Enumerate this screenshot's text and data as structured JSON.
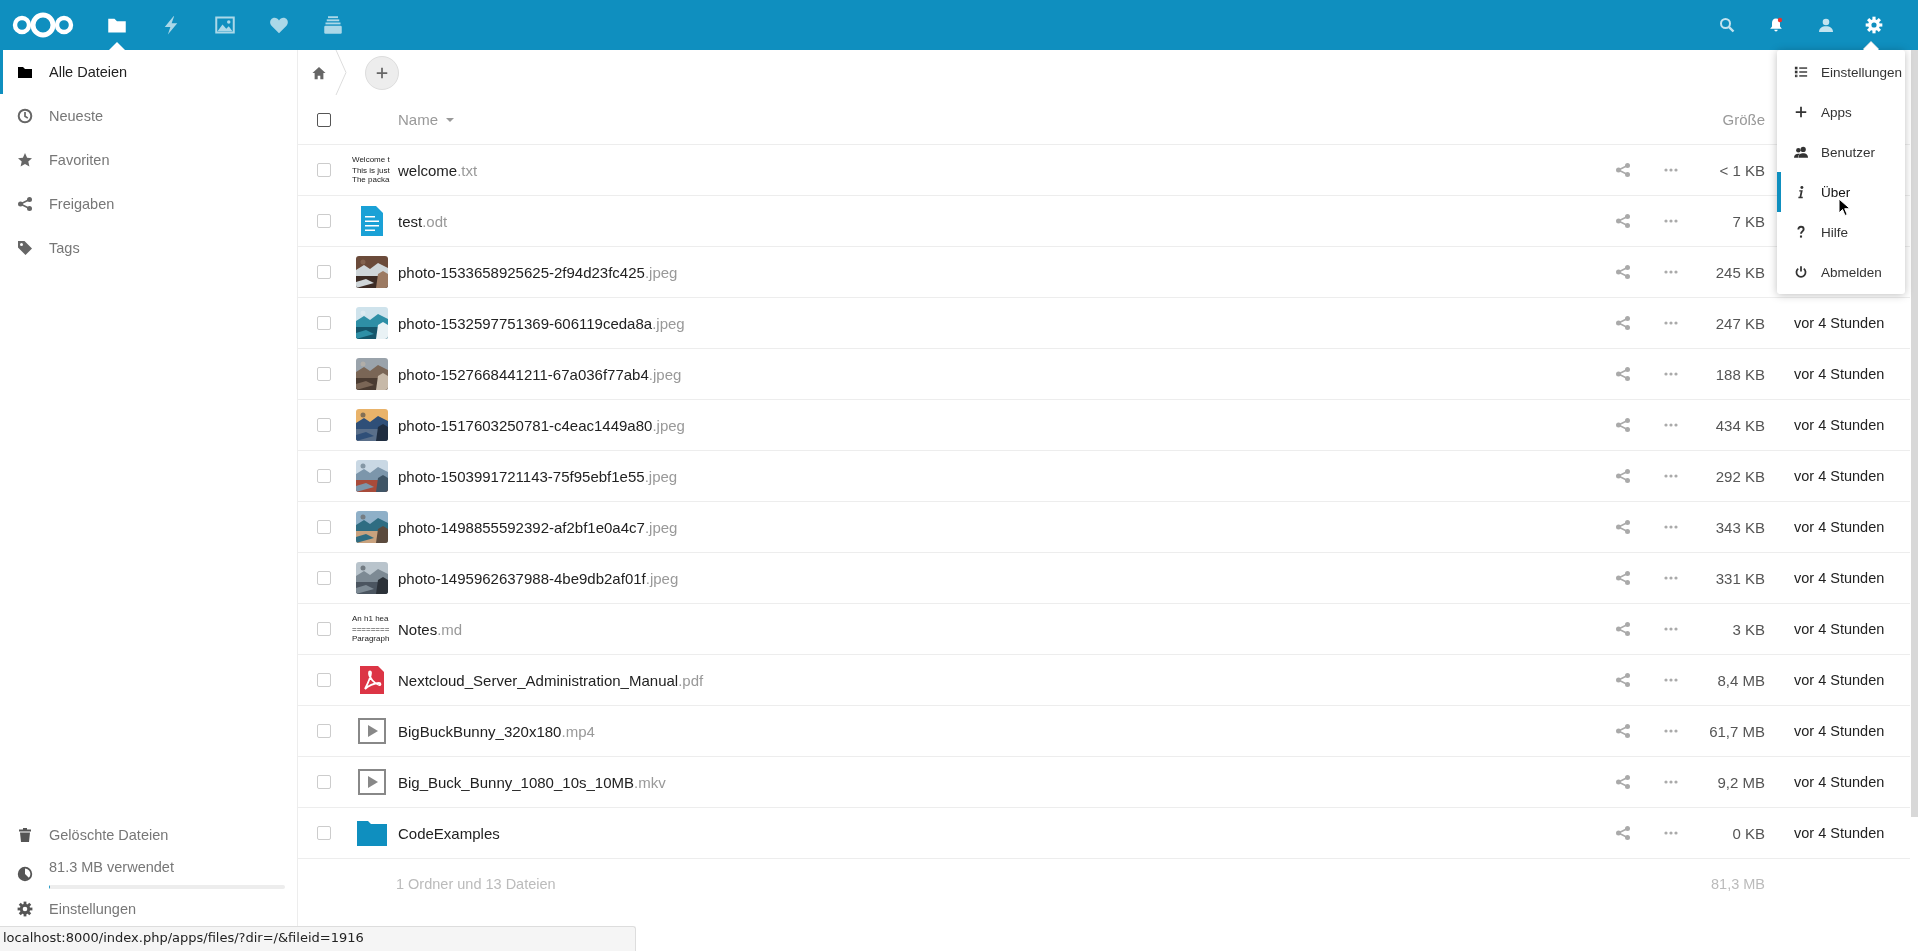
{
  "header": {
    "apps": [
      {
        "kind": "files",
        "selected": true
      },
      {
        "kind": "activity",
        "selected": false
      },
      {
        "kind": "photos",
        "selected": false
      },
      {
        "kind": "favorites",
        "selected": false
      },
      {
        "kind": "deck",
        "selected": false
      }
    ]
  },
  "sidebar": {
    "items": [
      {
        "label": "Alle Dateien",
        "kind": "files",
        "selected": true
      },
      {
        "label": "Neueste",
        "kind": "recent",
        "selected": false
      },
      {
        "label": "Favoriten",
        "kind": "favorites",
        "selected": false
      },
      {
        "label": "Freigaben",
        "kind": "shares",
        "selected": false
      },
      {
        "label": "Tags",
        "kind": "tags",
        "selected": false
      }
    ],
    "deleted": "Gelöschte Dateien",
    "quota": {
      "label": "81.3 MB verwendet",
      "level": 0.005
    },
    "settings": "Einstellungen"
  },
  "table": {
    "columns": [
      "Name",
      "Größe"
    ],
    "select_all": {
      "checked": false
    },
    "rows": [
      {
        "name": "welcome.txt",
        "thumb": {
          "kind": "text-preview",
          "lines": [
            "Welcome t",
            "This is just",
            "The packa"
          ]
        },
        "size": "< 1 KB",
        "checked": false
      },
      {
        "name": "test.odt",
        "thumb": {
          "kind": "document"
        },
        "size": "7 KB",
        "checked": false
      },
      {
        "name": "photo-1533658925625-2f94d23fc425.jpeg",
        "size": "245 KB",
        "checked": false
      },
      {
        "name": "photo-1532597751369-606119ceda8a.jpeg",
        "size": "247 KB",
        "modified": "vor 4 Stunden",
        "checked": false
      },
      {
        "name": "photo-1527668441211-67a036f77ab4.jpeg",
        "size": "188 KB",
        "modified": "vor 4 Stunden",
        "checked": false
      },
      {
        "name": "photo-1517603250781-c4eac1449a80.jpeg",
        "size": "434 KB",
        "modified": "vor 4 Stunden",
        "checked": false
      },
      {
        "name": "photo-1503991721143-75f95ebf1e55.jpeg",
        "size": "292 KB",
        "modified": "vor 4 Stunden",
        "checked": false
      },
      {
        "name": "photo-1498855592392-af2bf1e0a4c7.jpeg",
        "size": "343 KB",
        "modified": "vor 4 Stunden",
        "checked": false
      },
      {
        "name": "photo-1495962637988-4be9db2af01f.jpeg",
        "size": "331 KB",
        "modified": "vor 4 Stunden",
        "checked": false
      },
      {
        "name": "Notes.md",
        "thumb": {
          "kind": "text-preview",
          "lines": [
            "An h1 hea",
            "========",
            "Paragraph"
          ]
        },
        "size": "3 KB",
        "modified": "vor 4 Stunden",
        "checked": false
      },
      {
        "name": "Nextcloud_Server_Administration_Manual.pdf",
        "thumb": {
          "kind": "pdf"
        },
        "size": "8,4 MB",
        "modified": "vor 4 Stunden",
        "checked": false
      },
      {
        "name": "BigBuckBunny_320x180.mp4",
        "thumb": {
          "kind": "video"
        },
        "size": "61,7 MB",
        "modified": "vor 4 Stunden",
        "checked": false
      },
      {
        "name": "Big_Buck_Bunny_1080_10s_10MB.mkv",
        "thumb": {
          "kind": "video"
        },
        "size": "9,2 MB",
        "modified": "vor 4 Stunden",
        "checked": false
      },
      {
        "name": "CodeExamples",
        "thumb": {
          "kind": "folder"
        },
        "size": "0 KB",
        "modified": "vor 4 Stunden",
        "checked": false
      }
    ],
    "summary": {
      "label": "1 Ordner und 13 Dateien",
      "size": "81,3 MB"
    }
  },
  "menu": {
    "items": [
      {
        "label": "Einstellungen",
        "kind": "settings",
        "selected": false
      },
      {
        "label": "Apps",
        "kind": "apps",
        "selected": false
      },
      {
        "label": "Benutzer",
        "kind": "users",
        "selected": false
      },
      {
        "label": "Über",
        "kind": "about",
        "selected": true
      },
      {
        "label": "Hilfe",
        "kind": "help",
        "selected": false
      },
      {
        "label": "Abmelden",
        "kind": "logout",
        "selected": false
      }
    ]
  },
  "status_bar": "localhost:8000/index.php/apps/files/?dir=/&fileid=1916"
}
